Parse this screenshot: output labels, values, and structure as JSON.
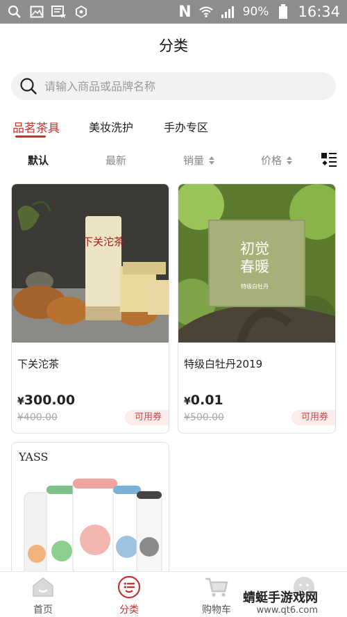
{
  "status_bar": {
    "battery": "90%",
    "time": "16:34",
    "notification_letter": "N"
  },
  "header": {
    "title": "分类"
  },
  "search": {
    "placeholder": "请输入商品或品牌名称"
  },
  "tabs": [
    {
      "label": "品茗茶具",
      "active": true
    },
    {
      "label": "美妆洗护",
      "active": false
    },
    {
      "label": "手办专区",
      "active": false
    }
  ],
  "sort": {
    "default": "默认",
    "newest": "最新",
    "sales": "销量",
    "price": "价格"
  },
  "products": [
    {
      "name": "下关沱茶",
      "currency": "¥",
      "price": "300.00",
      "old_price": "¥400.00",
      "coupon": "可用券",
      "image_text": "下关沱茶"
    },
    {
      "name": "特级白牡丹2019",
      "currency": "¥",
      "price": "0.01",
      "old_price": "¥500.00",
      "coupon": "可用券",
      "image_text_1": "初觉",
      "image_text_2": "春暖",
      "image_text_3": "特级白牡丹"
    },
    {
      "brand": "YASS"
    }
  ],
  "bottom_nav": [
    {
      "label": "首页",
      "icon": "home-icon",
      "active": false
    },
    {
      "label": "分类",
      "icon": "category-icon",
      "active": true
    },
    {
      "label": "购物车",
      "icon": "cart-icon",
      "active": false
    },
    {
      "label": "",
      "icon": "profile-icon",
      "active": false
    }
  ],
  "watermark": {
    "text": "蜻蜓手游戏网",
    "url": "www.qt6.com"
  },
  "colors": {
    "accent": "#c7322f",
    "status_bar": "#8d8d8d",
    "coupon_bg": "#fdecec"
  }
}
